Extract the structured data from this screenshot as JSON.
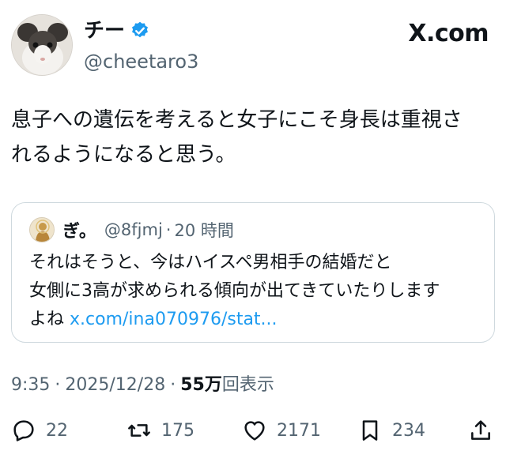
{
  "author": {
    "name": "チー",
    "handle": "@cheetaro3",
    "verified": true
  },
  "brand": "X.com",
  "tweet": {
    "lines": [
      "息子への遺伝を考えると女子にこそ身長は重視さ",
      "れるようになると思う。"
    ]
  },
  "quote": {
    "name": "ぎ。",
    "handle": "@8fjmj",
    "separator": "·",
    "time": "20 時間",
    "lines": [
      "それはそうと、今はハイスペ男相手の結婚だと",
      "女側に3高が求められる傾向が出てきていたりします"
    ],
    "last_line_text": "よね",
    "link": "x.com/ina070976/stat..."
  },
  "meta": {
    "time": "9:35",
    "separator": "·",
    "date": "2025/12/28",
    "separator2": "·",
    "views": "55万",
    "views_label": "回表示"
  },
  "actions": {
    "replies": "22",
    "reposts": "175",
    "likes": "2171",
    "bookmarks": "234"
  },
  "colors": {
    "text": "#0f1419",
    "secondary": "#536471",
    "link": "#1d9bf0",
    "verified": "#1d9bf0",
    "border": "#cfd9de"
  }
}
